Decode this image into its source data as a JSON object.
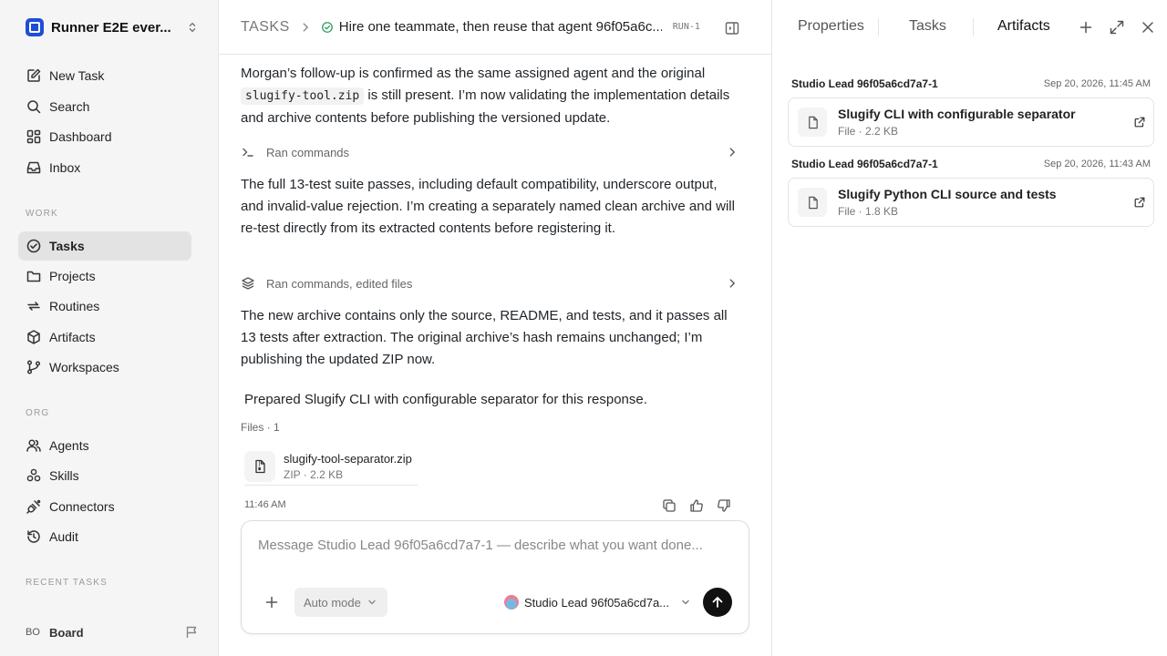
{
  "workspace": {
    "name": "Runner E2E ever...",
    "logo_icon": "workspace-logo-icon"
  },
  "nav_primary": [
    {
      "label": "New Task",
      "icon": "edit-icon"
    },
    {
      "label": "Search",
      "icon": "search-icon"
    },
    {
      "label": "Dashboard",
      "icon": "dashboard-icon"
    },
    {
      "label": "Inbox",
      "icon": "inbox-icon"
    }
  ],
  "sections": {
    "work": "WORK",
    "org": "ORG",
    "recent": "RECENT TASKS"
  },
  "nav_work": [
    {
      "label": "Tasks",
      "icon": "check-circle-icon",
      "active": true
    },
    {
      "label": "Projects",
      "icon": "folder-icon"
    },
    {
      "label": "Routines",
      "icon": "repeat-icon"
    },
    {
      "label": "Artifacts",
      "icon": "cube-icon"
    },
    {
      "label": "Workspaces",
      "icon": "branch-icon"
    }
  ],
  "nav_org": [
    {
      "label": "Agents",
      "icon": "users-icon"
    },
    {
      "label": "Skills",
      "icon": "skills-icon"
    },
    {
      "label": "Connectors",
      "icon": "plug-icon"
    },
    {
      "label": "Audit",
      "icon": "history-icon"
    }
  ],
  "board": {
    "initials": "BO",
    "label": "Board"
  },
  "header": {
    "root": "TASKS",
    "title": "Hire one teammate, then reuse that agent 96f05a6c...",
    "run_id": "RUN-1"
  },
  "conversation": {
    "msg1": {
      "part1": "Morgan’s follow-up is confirmed as the same assigned agent and the original ",
      "code": "slugify-tool.zip",
      "part2": " is still present. I’m now validating the implementation details and archive contents before publishing the versioned update."
    },
    "cmd1": "Ran commands",
    "msg2": "The full 13-test suite passes, including default compatibility, underscore output, and invalid-value rejection. I’m creating a separately named clean archive and will re-test directly from its extracted contents before registering it.",
    "cmd2": "Ran commands, edited files",
    "msg3": "The new archive contains only the source, README, and tests, and it passes all 13 tests after extraction. The original archive’s hash remains unchanged; I’m publishing the updated ZIP now.",
    "prepared": "Prepared Slugify CLI with configurable separator for this response.",
    "files_label": "Files · 1",
    "file": {
      "name": "slugify-tool-separator.zip",
      "meta": "ZIP · 2.2 KB"
    },
    "time": "11:46 AM"
  },
  "composer": {
    "placeholder": "Message Studio Lead 96f05a6cd7a7-1 — describe what you want done...",
    "mode": "Auto mode",
    "agent": "Studio Lead 96f05a6cd7a..."
  },
  "right_panel": {
    "tabs": [
      "Properties",
      "Tasks",
      "Artifacts"
    ],
    "active_tab": "Artifacts",
    "groups": [
      {
        "title": "Studio Lead 96f05a6cd7a7-1",
        "date": "Sep 20, 2026, 11:45 AM",
        "artifact": {
          "name": "Slugify CLI with configurable separator",
          "meta": "File · 2.2 KB"
        }
      },
      {
        "title": "Studio Lead 96f05a6cd7a7-1",
        "date": "Sep 20, 2026, 11:43 AM",
        "artifact": {
          "name": "Slugify Python CLI source and tests",
          "meta": "File · 1.8 KB"
        }
      }
    ]
  }
}
